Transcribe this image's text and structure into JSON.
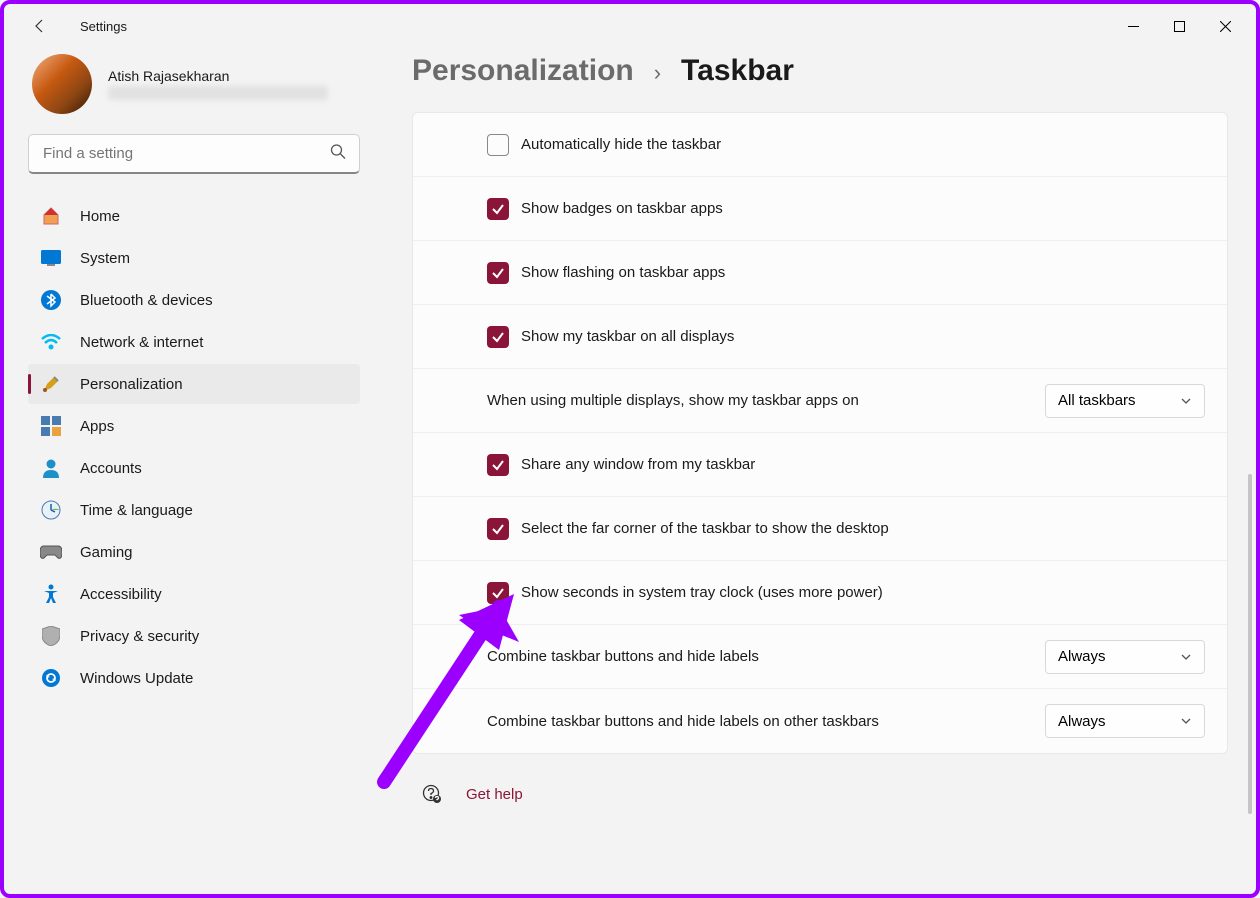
{
  "window": {
    "title": "Settings"
  },
  "user": {
    "name": "Atish Rajasekharan"
  },
  "search": {
    "placeholder": "Find a setting"
  },
  "sidebar": {
    "items": [
      {
        "label": "Home",
        "icon": "home",
        "selected": false
      },
      {
        "label": "System",
        "icon": "system",
        "selected": false
      },
      {
        "label": "Bluetooth & devices",
        "icon": "bluetooth",
        "selected": false
      },
      {
        "label": "Network & internet",
        "icon": "network",
        "selected": false
      },
      {
        "label": "Personalization",
        "icon": "personalization",
        "selected": true
      },
      {
        "label": "Apps",
        "icon": "apps",
        "selected": false
      },
      {
        "label": "Accounts",
        "icon": "accounts",
        "selected": false
      },
      {
        "label": "Time & language",
        "icon": "time",
        "selected": false
      },
      {
        "label": "Gaming",
        "icon": "gaming",
        "selected": false
      },
      {
        "label": "Accessibility",
        "icon": "accessibility",
        "selected": false
      },
      {
        "label": "Privacy & security",
        "icon": "privacy",
        "selected": false
      },
      {
        "label": "Windows Update",
        "icon": "update",
        "selected": false
      }
    ]
  },
  "breadcrumb": {
    "parent": "Personalization",
    "current": "Taskbar"
  },
  "settings": [
    {
      "type": "checkbox",
      "label": "Automatically hide the taskbar",
      "checked": false
    },
    {
      "type": "checkbox",
      "label": "Show badges on taskbar apps",
      "checked": true
    },
    {
      "type": "checkbox",
      "label": "Show flashing on taskbar apps",
      "checked": true
    },
    {
      "type": "checkbox",
      "label": "Show my taskbar on all displays",
      "checked": true
    },
    {
      "type": "dropdown",
      "label": "When using multiple displays, show my taskbar apps on",
      "value": "All taskbars"
    },
    {
      "type": "checkbox",
      "label": "Share any window from my taskbar",
      "checked": true
    },
    {
      "type": "checkbox",
      "label": "Select the far corner of the taskbar to show the desktop",
      "checked": true
    },
    {
      "type": "checkbox",
      "label": "Show seconds in system tray clock (uses more power)",
      "checked": true
    },
    {
      "type": "dropdown",
      "label": "Combine taskbar buttons and hide labels",
      "value": "Always"
    },
    {
      "type": "dropdown",
      "label": "Combine taskbar buttons and hide labels on other taskbars",
      "value": "Always"
    }
  ],
  "help": {
    "label": "Get help"
  },
  "colors": {
    "accent": "#8b1538",
    "annotation": "#9b00ff"
  }
}
